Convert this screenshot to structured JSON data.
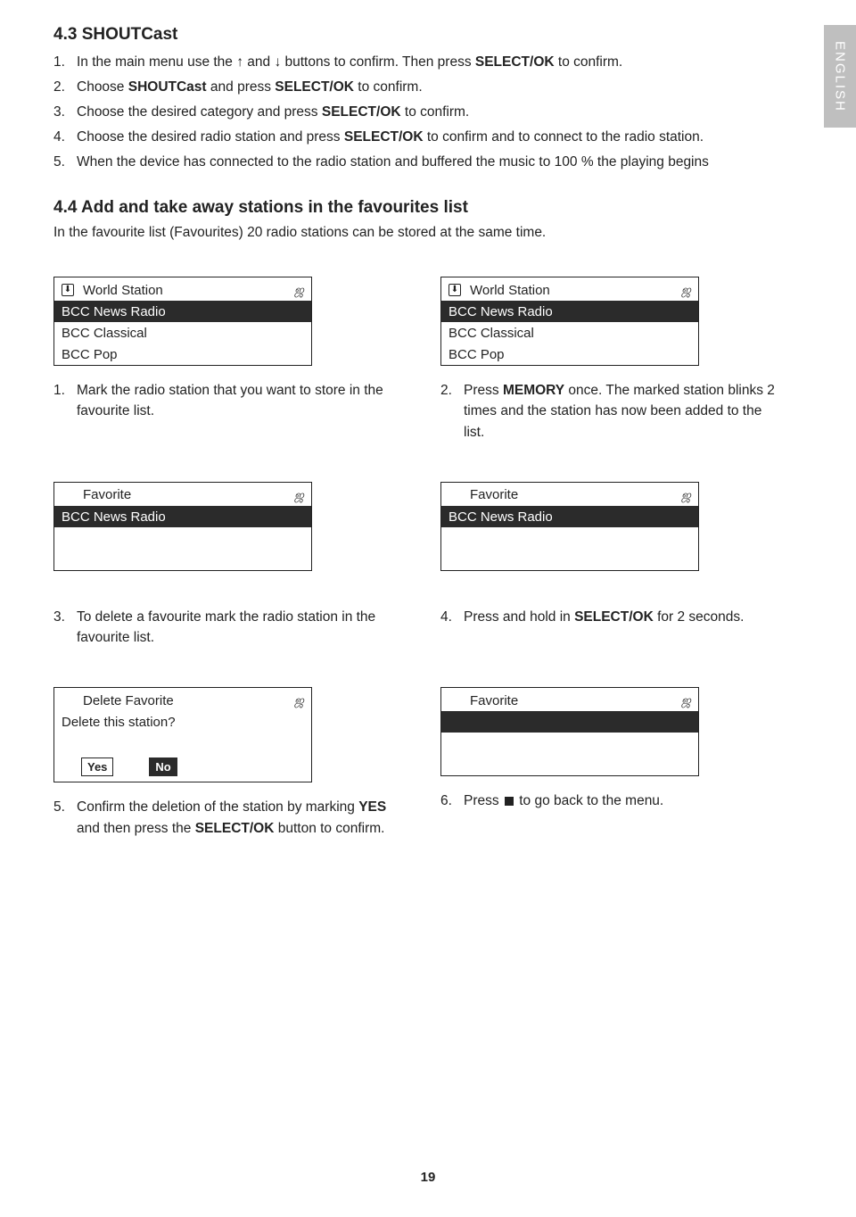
{
  "side_tab": "ENGLISH",
  "s43": {
    "title": "4.3 SHOUTCast",
    "items": [
      {
        "n": "1.",
        "pre": "In the main menu use the ↑ and ↓ buttons to confirm. Then press ",
        "b": "SELECT/OK",
        "post": " to confirm."
      },
      {
        "n": "2.",
        "pre": "Choose ",
        "b": "SHOUTCast",
        "post": " and press ",
        "b2": "SELECT/OK",
        "post2": " to confirm."
      },
      {
        "n": "3.",
        "pre": "Choose the desired category and press ",
        "b": "SELECT/OK",
        "post": " to confirm."
      },
      {
        "n": "4.",
        "pre": "Choose the desired radio station and press ",
        "b": "SELECT/OK",
        "post": " to confirm and to connect to the radio station."
      },
      {
        "n": "5.",
        "pre": "When the device has connected to the radio station and buffered the music to 100 % the playing begins",
        "b": "",
        "post": ""
      }
    ]
  },
  "s44": {
    "title": "4.4 Add and take away stations in the favourites list",
    "intro": "In the favourite list (Favourites) 20 radio stations can be stored at the same time."
  },
  "lcd_world": {
    "title": "World Station",
    "r1": "BCC News Radio",
    "r2": "BCC Classical",
    "r3": "BCC Pop"
  },
  "cap1": {
    "n": "1.",
    "t": "Mark the radio station that you want to store in the favourite list."
  },
  "cap2": {
    "n": "2.",
    "pre": "Press ",
    "b": "MEMORY",
    "post": " once. The marked station blinks 2 times and the station has now been added to the list."
  },
  "lcd_fav": {
    "title": "Favorite",
    "r1": "BCC News Radio"
  },
  "cap3": {
    "n": "3.",
    "t": "To delete a favourite mark the radio station in the favourite list."
  },
  "cap4": {
    "n": "4.",
    "pre": "Press and hold in ",
    "b": "SELECT/OK",
    "post": " for 2 seconds."
  },
  "lcd_del": {
    "title": "Delete Favorite",
    "q": "Delete this station?",
    "yes": "Yes",
    "no": "No"
  },
  "lcd_fav2": {
    "title": "Favorite"
  },
  "cap5": {
    "n": "5.",
    "pre": "Confirm the deletion of the station by marking ",
    "b": "YES",
    "mid": " and then press the ",
    "b2": "SELECT/OK",
    "post": " button to confirm."
  },
  "cap6": {
    "n": "6.",
    "pre": "Press ",
    "post": " to go back to the menu."
  },
  "page": "19"
}
